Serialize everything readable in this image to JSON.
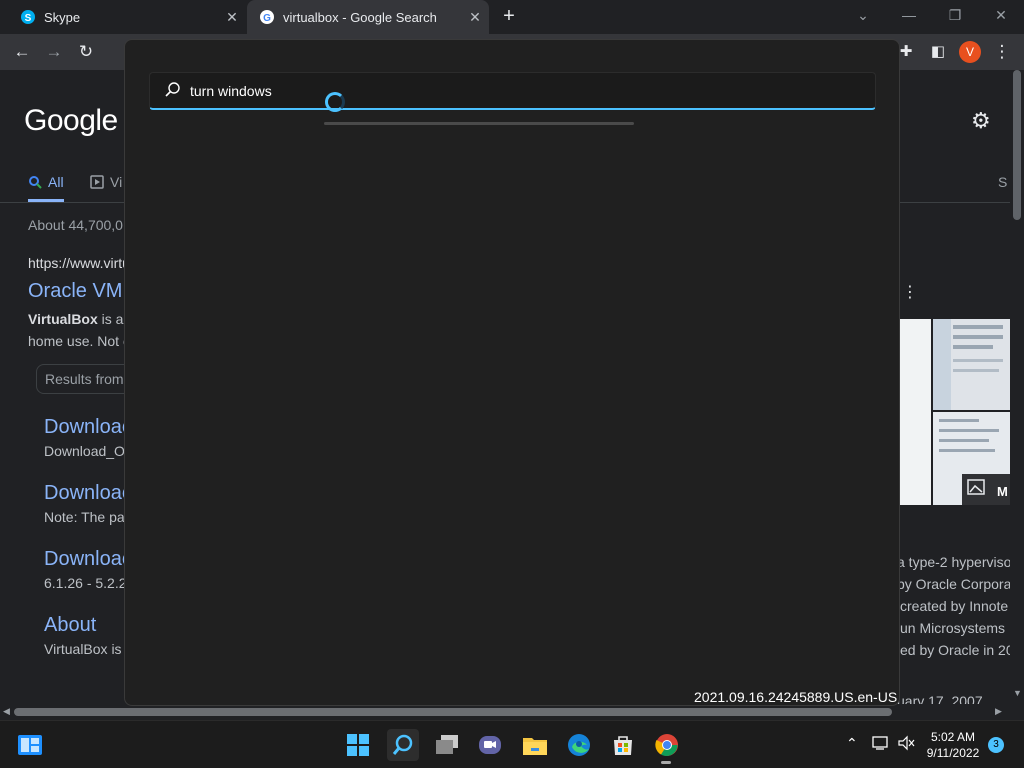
{
  "browser": {
    "tabs": [
      {
        "label": "Skype",
        "active": false
      },
      {
        "label": "virtualbox - Google Search",
        "active": true
      }
    ],
    "avatar_letter": "V"
  },
  "page": {
    "logo": "Google",
    "tabs": {
      "all": "All",
      "videos": "Vi"
    },
    "results_count": "About 44,700,0",
    "url": "https://www.virtu",
    "title": "Oracle VM",
    "snippet_bold": "VirtualBox",
    "snippet_rest": " is a",
    "snippet_line2": "home use. Not c",
    "results_from": "Results from v",
    "sublinks": [
      {
        "title": "Downloac",
        "desc": "Download_O"
      },
      {
        "title": "Downloac",
        "desc": "Note: The pa"
      },
      {
        "title": "Downloac",
        "desc": "6.1.26 - 5.2.2"
      },
      {
        "title": "About",
        "desc": "VirtualBox is"
      }
    ],
    "right_text": [
      "a type-2 hyperviso",
      "by Oracle Corpora",
      "created by Innote",
      "un Microsystems",
      "ed by Oracle in 20"
    ],
    "right_bottom": "uary 17, 2007",
    "right_partial": "S",
    "more_images": "M"
  },
  "search": {
    "query": "turn windows",
    "version": "2021.09.16.24245889.US.en-US"
  },
  "taskbar": {
    "time": "5:02 AM",
    "date": "9/11/2022",
    "notifications": "3"
  }
}
